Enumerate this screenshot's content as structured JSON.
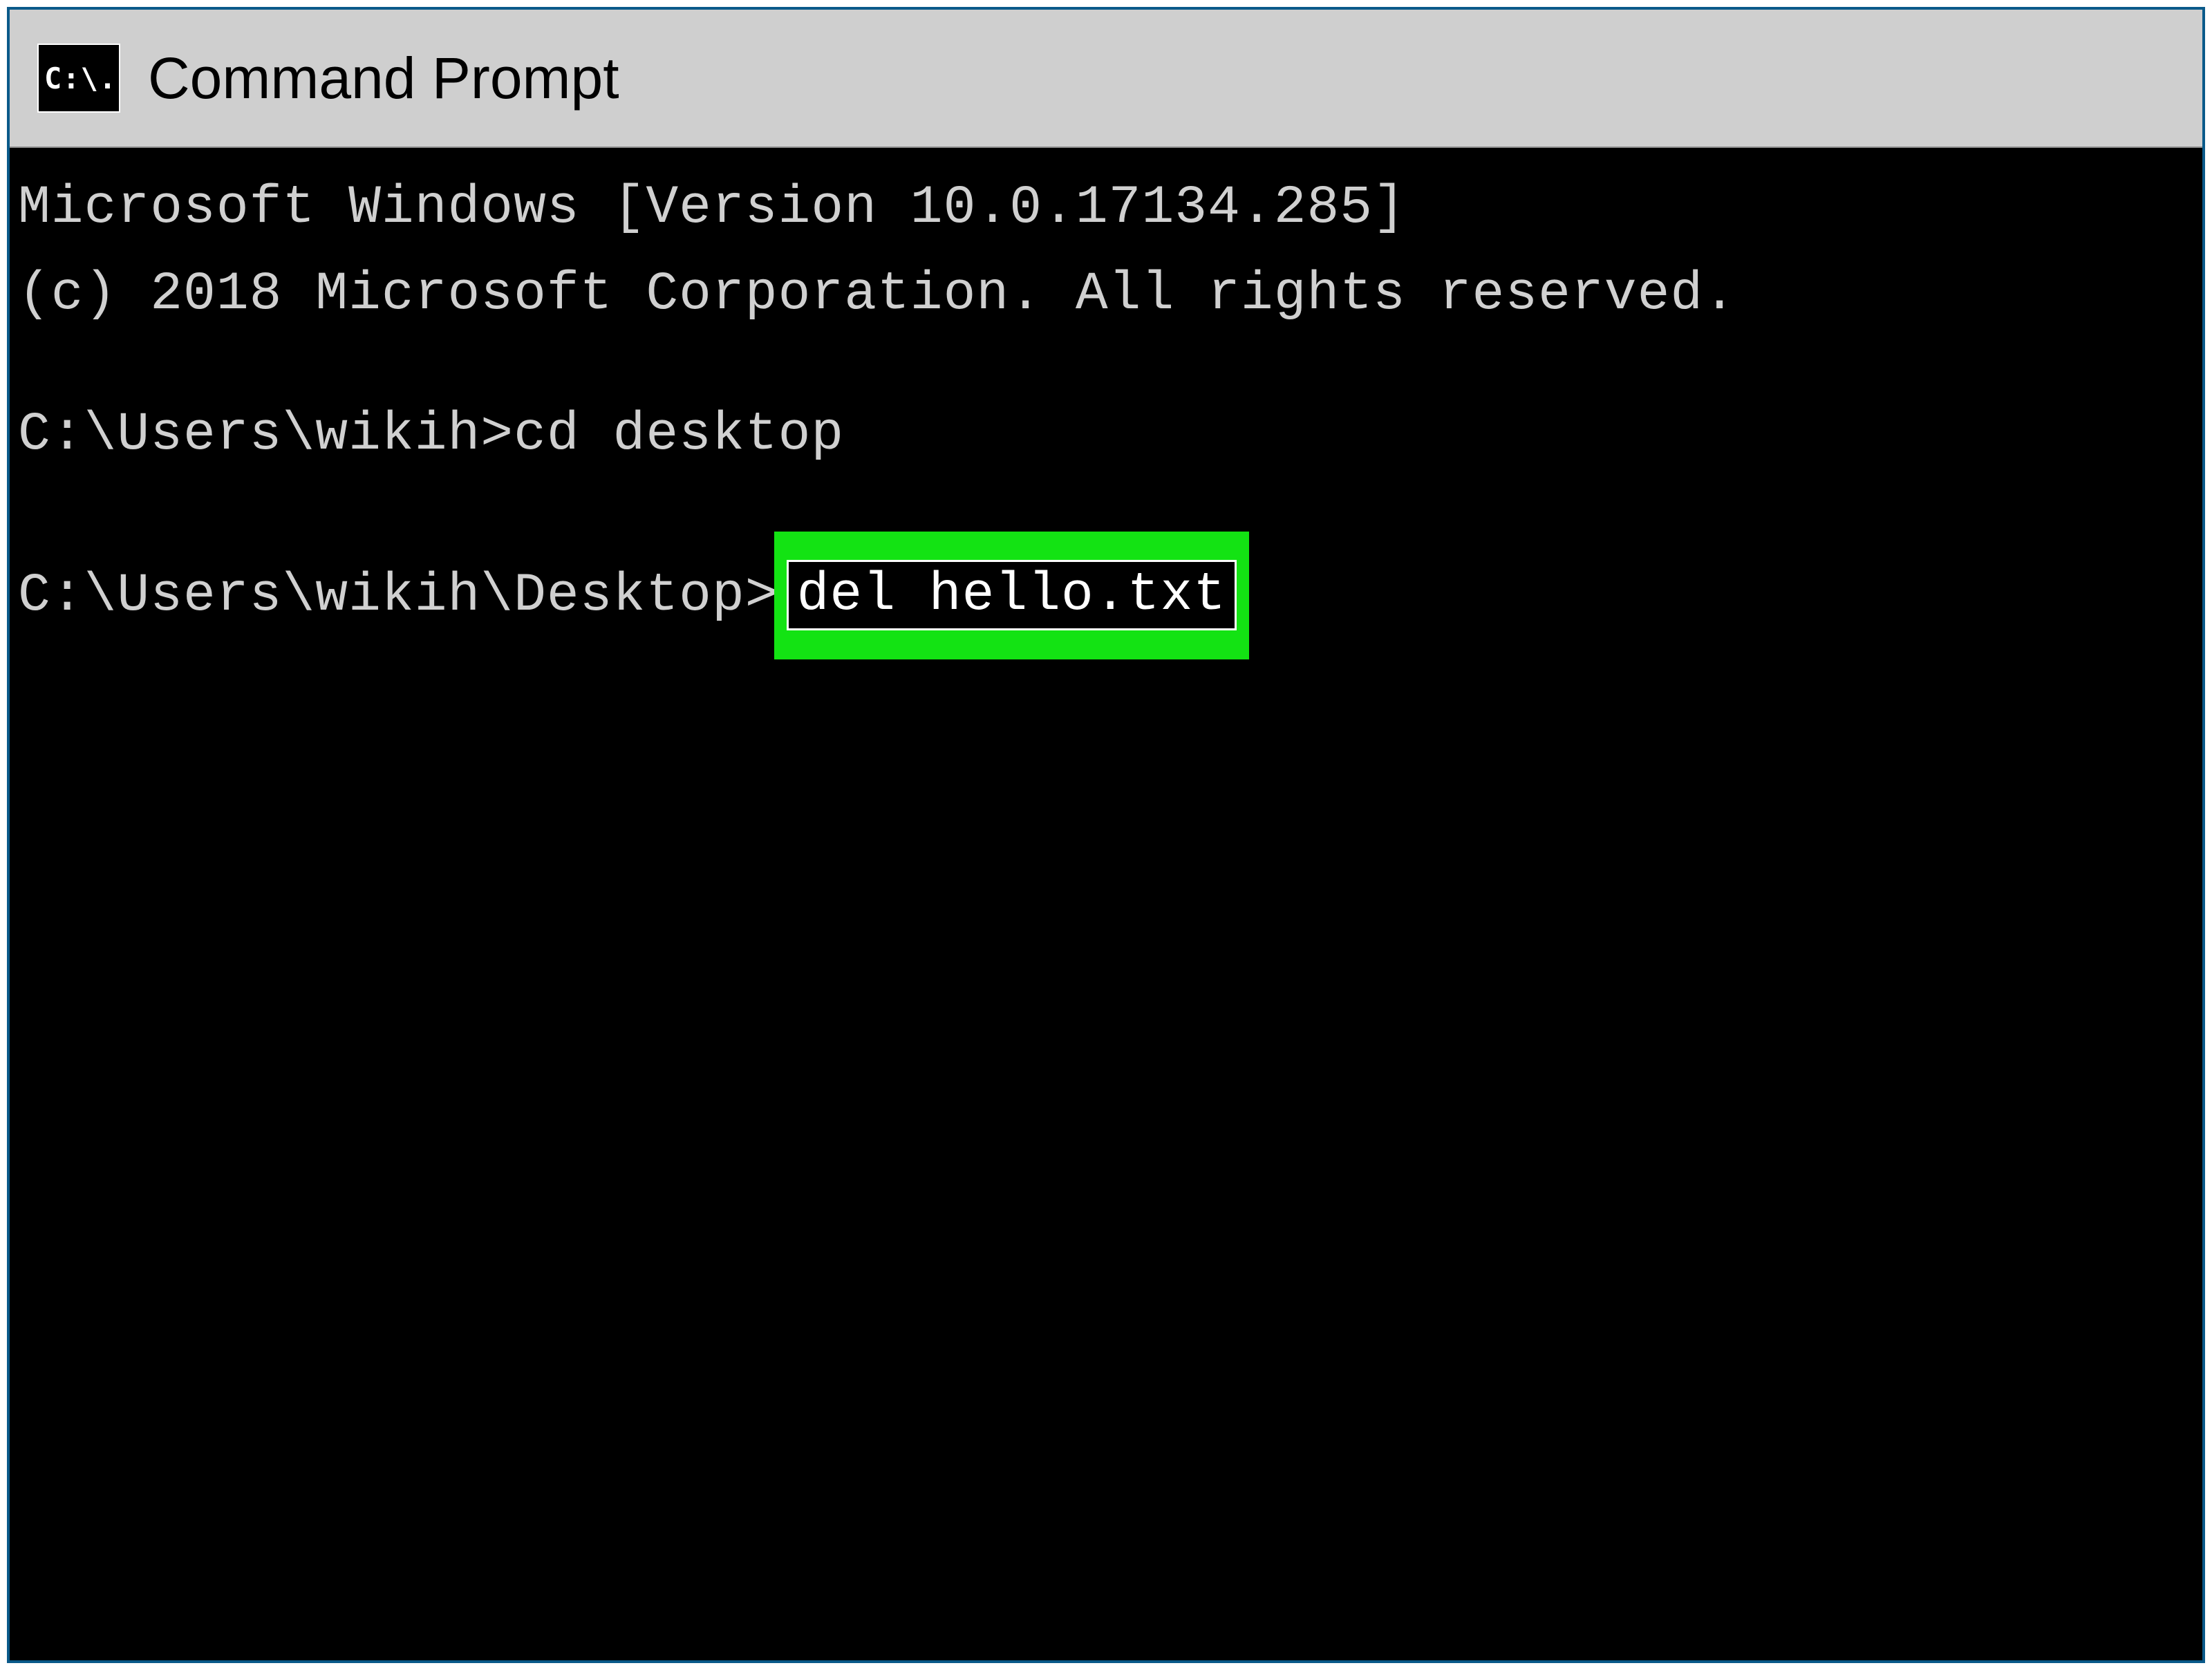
{
  "window": {
    "title": "Command Prompt",
    "icon_label": "C:\\."
  },
  "terminal": {
    "line1": "Microsoft Windows [Version 10.0.17134.285]",
    "line2": "(c) 2018 Microsoft Corporation. All rights reserved.",
    "prompt1": "C:\\Users\\wikih>",
    "cmd1": "cd desktop",
    "prompt2": "C:\\Users\\wikih\\Desktop>",
    "cmd2": "del hello.txt"
  },
  "colors": {
    "titlebar_bg": "#cfcfcf",
    "terminal_bg": "#000000",
    "terminal_fg": "#d0d0d0",
    "highlight": "#13e313",
    "window_border": "#0a5a8a"
  }
}
